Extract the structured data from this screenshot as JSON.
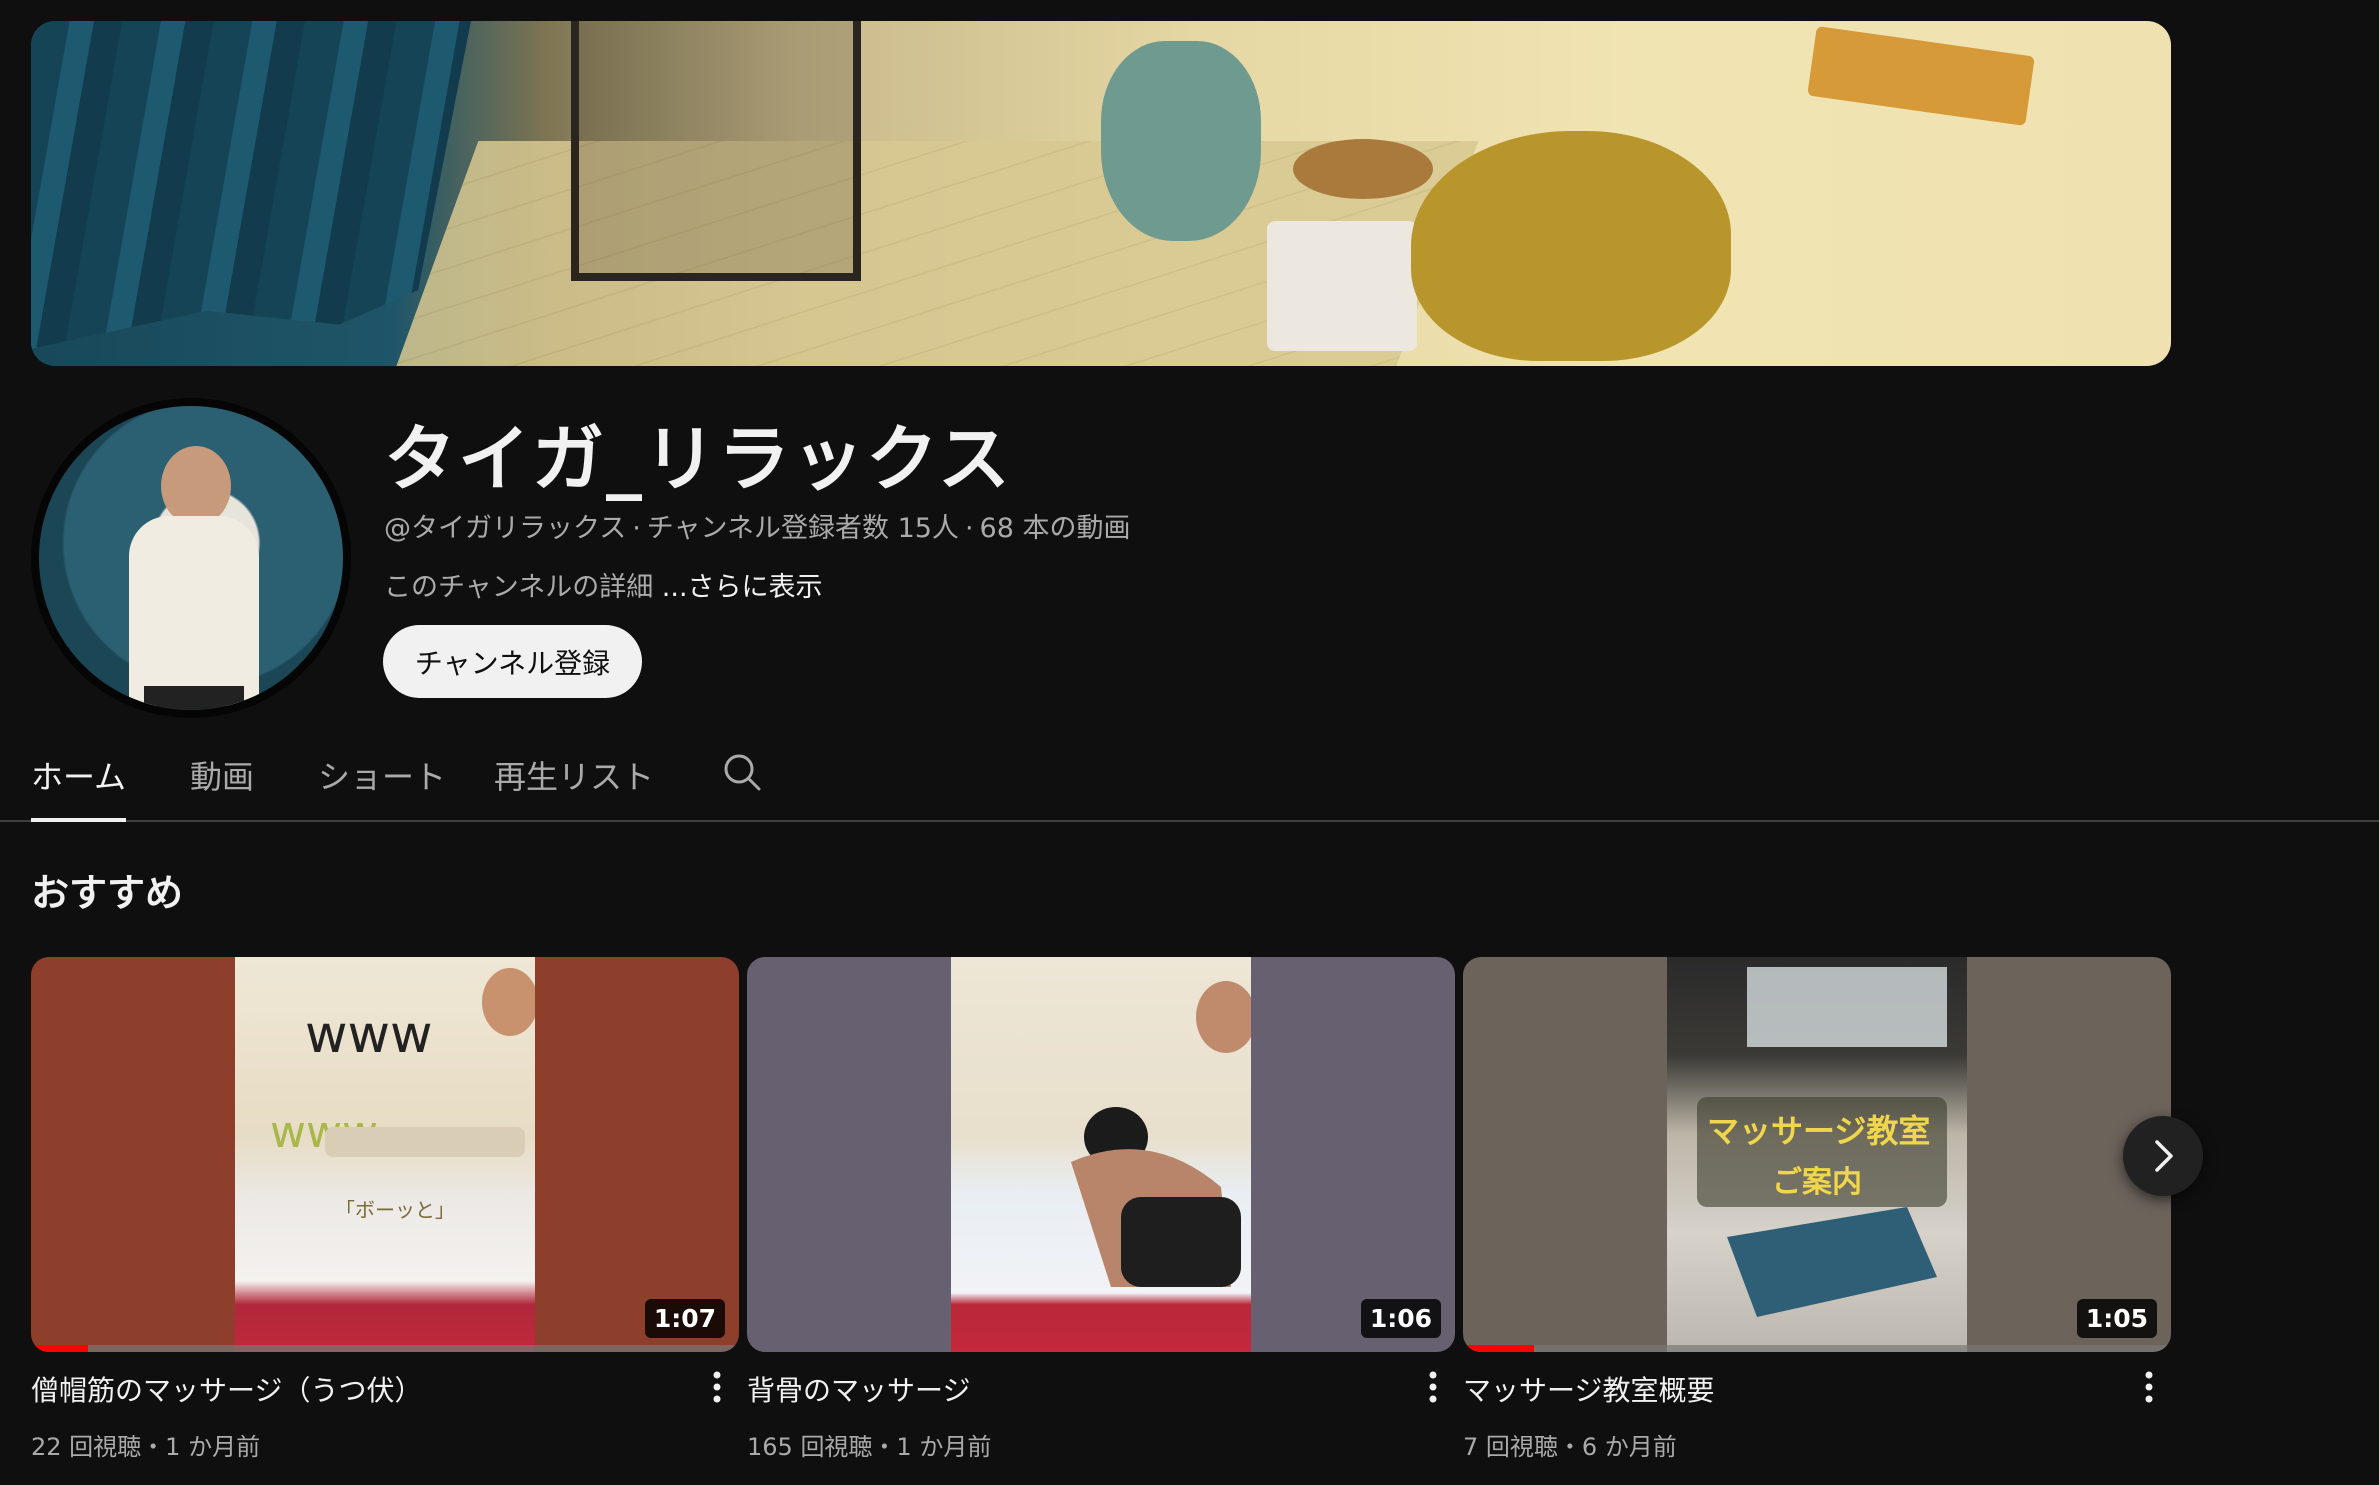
{
  "channel": {
    "name": "タイガ_リラックス",
    "handle": "@タイガリラックス",
    "subscribers": "チャンネル登録者数 15人",
    "videos": "68 本の動画",
    "description": "このチャンネルの詳細",
    "more_label": "...さらに表示",
    "subscribe_label": "チャンネル登録"
  },
  "tabs": [
    {
      "label": "ホーム",
      "active": true
    },
    {
      "label": "動画",
      "active": false
    },
    {
      "label": "ショート",
      "active": false
    },
    {
      "label": "再生リスト",
      "active": false
    }
  ],
  "icons": {
    "tab_search": "search-icon",
    "next": "chevron-right-icon",
    "more": "more-vert-icon"
  },
  "section": {
    "title": "おすすめ"
  },
  "videos": [
    {
      "title": "僧帽筋のマッサージ（うつ伏）",
      "meta": "22 回視聴・1 か月前",
      "duration": "1:07",
      "progress": 0.08
    },
    {
      "title": "背骨のマッサージ",
      "meta": "165 回視聴・1 か月前",
      "duration": "1:06",
      "progress": 0
    },
    {
      "title": "マッサージ教室概要",
      "meta": "7 回視聴・6 か月前",
      "duration": "1:05",
      "progress": 0.1
    }
  ],
  "thumbnail_overlays": {
    "v0": [
      "www",
      "www",
      "「ボーッと」"
    ],
    "v2": [
      "マッサージ教室",
      "ご案内"
    ]
  },
  "colors": {
    "background": "#0f0f0f",
    "text": "#f1f1f1",
    "secondary_text": "#aaaaaa",
    "progress": "#ff0000"
  }
}
